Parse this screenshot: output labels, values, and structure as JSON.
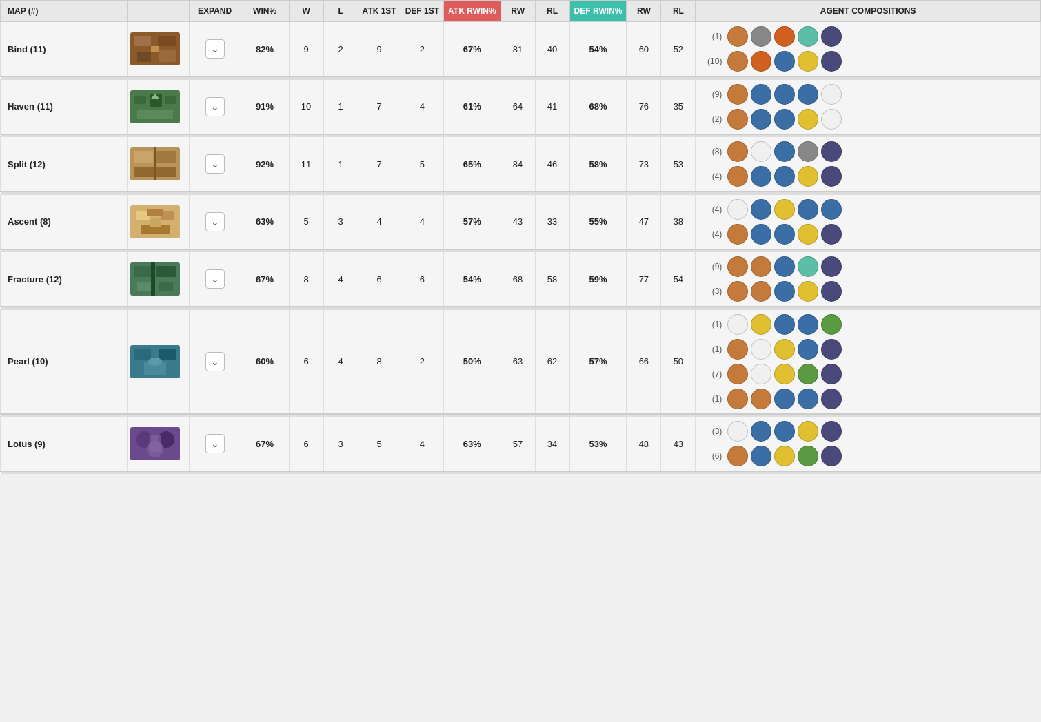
{
  "header": {
    "columns": [
      {
        "id": "map",
        "label": "MAP (#)",
        "class": ""
      },
      {
        "id": "expand",
        "label": "EXPAND",
        "class": ""
      },
      {
        "id": "winpct",
        "label": "WIN%",
        "class": ""
      },
      {
        "id": "w",
        "label": "W",
        "class": ""
      },
      {
        "id": "l",
        "label": "L",
        "class": ""
      },
      {
        "id": "atk1st",
        "label": "ATK 1ST",
        "class": ""
      },
      {
        "id": "def1st",
        "label": "DEF 1ST",
        "class": ""
      },
      {
        "id": "atk_rwin",
        "label": "ATK RWIN%",
        "class": "atk-rwin"
      },
      {
        "id": "atk_rw",
        "label": "RW",
        "class": ""
      },
      {
        "id": "atk_rl",
        "label": "RL",
        "class": ""
      },
      {
        "id": "def_rwin",
        "label": "DEF RWIN%",
        "class": "def-rwin"
      },
      {
        "id": "def_rw",
        "label": "RW",
        "class": ""
      },
      {
        "id": "def_rl",
        "label": "RL",
        "class": ""
      },
      {
        "id": "agent_comp",
        "label": "AGENT COMPOSITIONS",
        "class": "agent-comp"
      }
    ]
  },
  "maps": [
    {
      "name": "Bind (11)",
      "bg_class": "bind-bg",
      "win_pct": "82%",
      "w": "9",
      "l": "2",
      "atk_1st": "9",
      "def_1st": "2",
      "atk_rwin": "67%",
      "atk_rw": "81",
      "atk_rl": "40",
      "def_rwin": "54%",
      "def_rw": "60",
      "def_rl": "52",
      "compositions": [
        {
          "count": "(1)",
          "agents": [
            "🟠",
            "🟤",
            "🔵",
            "🟢",
            "⚫"
          ]
        },
        {
          "count": "(10)",
          "agents": [
            "🟤",
            "🟤",
            "🔵",
            "🟡",
            "⚫"
          ]
        }
      ]
    },
    {
      "name": "Haven (11)",
      "bg_class": "haven-bg",
      "win_pct": "91%",
      "w": "10",
      "l": "1",
      "atk_1st": "7",
      "def_1st": "4",
      "atk_rwin": "61%",
      "atk_rw": "64",
      "atk_rl": "41",
      "def_rwin": "68%",
      "def_rw": "76",
      "def_rl": "35",
      "compositions": [
        {
          "count": "(9)",
          "agents": [
            "🟤",
            "🔵",
            "🔵",
            "🔵",
            "⚪"
          ]
        },
        {
          "count": "(2)",
          "agents": [
            "🟤",
            "🔵",
            "🔵",
            "🟡",
            "⚪"
          ]
        }
      ]
    },
    {
      "name": "Split (12)",
      "bg_class": "split-bg",
      "win_pct": "92%",
      "w": "11",
      "l": "1",
      "atk_1st": "7",
      "def_1st": "5",
      "atk_rwin": "65%",
      "atk_rw": "84",
      "atk_rl": "46",
      "def_rwin": "58%",
      "def_rw": "73",
      "def_rl": "53",
      "compositions": [
        {
          "count": "(8)",
          "agents": [
            "🟤",
            "⚪",
            "🔵",
            "🟤",
            "⚫"
          ]
        },
        {
          "count": "(4)",
          "agents": [
            "🟤",
            "🔵",
            "🔵",
            "🟡",
            "⚫"
          ]
        }
      ]
    },
    {
      "name": "Ascent (8)",
      "bg_class": "ascent-bg",
      "win_pct": "63%",
      "w": "5",
      "l": "3",
      "atk_1st": "4",
      "def_1st": "4",
      "atk_rwin": "57%",
      "atk_rw": "43",
      "atk_rl": "33",
      "def_rwin": "55%",
      "def_rw": "47",
      "def_rl": "38",
      "compositions": [
        {
          "count": "(4)",
          "agents": [
            "⚪",
            "🔵",
            "🟡",
            "🔵",
            "🔵"
          ]
        },
        {
          "count": "(4)",
          "agents": [
            "🟤",
            "🔵",
            "🔵",
            "🟡",
            "⚫"
          ]
        }
      ]
    },
    {
      "name": "Fracture (12)",
      "bg_class": "fracture-bg",
      "win_pct": "67%",
      "w": "8",
      "l": "4",
      "atk_1st": "6",
      "def_1st": "6",
      "atk_rwin": "54%",
      "atk_rw": "68",
      "atk_rl": "58",
      "def_rwin": "59%",
      "def_rw": "77",
      "def_rl": "54",
      "compositions": [
        {
          "count": "(9)",
          "agents": [
            "🟤",
            "🟤",
            "🔵",
            "🟢",
            "⚫"
          ]
        },
        {
          "count": "(3)",
          "agents": [
            "🟤",
            "🟤",
            "🔵",
            "🟡",
            "⚫"
          ]
        }
      ]
    },
    {
      "name": "Pearl (10)",
      "bg_class": "pearl-bg",
      "win_pct": "60%",
      "w": "6",
      "l": "4",
      "atk_1st": "8",
      "def_1st": "2",
      "atk_rwin": "50%",
      "atk_rw": "63",
      "atk_rl": "62",
      "def_rwin": "57%",
      "def_rw": "66",
      "def_rl": "50",
      "compositions": [
        {
          "count": "(1)",
          "agents": [
            "⚪",
            "🟡",
            "🔵",
            "🔵",
            "🟢"
          ]
        },
        {
          "count": "(1)",
          "agents": [
            "🟤",
            "⚪",
            "🟡",
            "🔵",
            "⚫"
          ]
        },
        {
          "count": "(7)",
          "agents": [
            "🟤",
            "⚪",
            "🟡",
            "🟢",
            "⚫"
          ]
        },
        {
          "count": "(1)",
          "agents": [
            "🟤",
            "🟤",
            "🔵",
            "🔵",
            "⚫"
          ]
        }
      ]
    },
    {
      "name": "Lotus (9)",
      "bg_class": "lotus-bg",
      "win_pct": "67%",
      "w": "6",
      "l": "3",
      "atk_1st": "5",
      "def_1st": "4",
      "atk_rwin": "63%",
      "atk_rw": "57",
      "atk_rl": "34",
      "def_rwin": "53%",
      "def_rw": "48",
      "def_rl": "43",
      "compositions": [
        {
          "count": "(3)",
          "agents": [
            "⚪",
            "🔵",
            "🔵",
            "🟡",
            "⚫"
          ]
        },
        {
          "count": "(6)",
          "agents": [
            "🟤",
            "🔵",
            "🟡",
            "🟢",
            "⚫"
          ]
        }
      ]
    }
  ],
  "agent_colors": {
    "colors": [
      "#c47a3a",
      "#5bbfa8",
      "#3a6ea5",
      "#4a9e4a",
      "#888888",
      "#7c3a9e",
      "#e0c030",
      "#d06020",
      "#4a4a7a",
      "#a0c8e0",
      "#d0704a",
      "#5a9a40",
      "#3050a0",
      "#7050b0",
      "#607080",
      "#c0a030",
      "#4090d0",
      "#503060",
      "#2070a0",
      "#70a030"
    ]
  }
}
